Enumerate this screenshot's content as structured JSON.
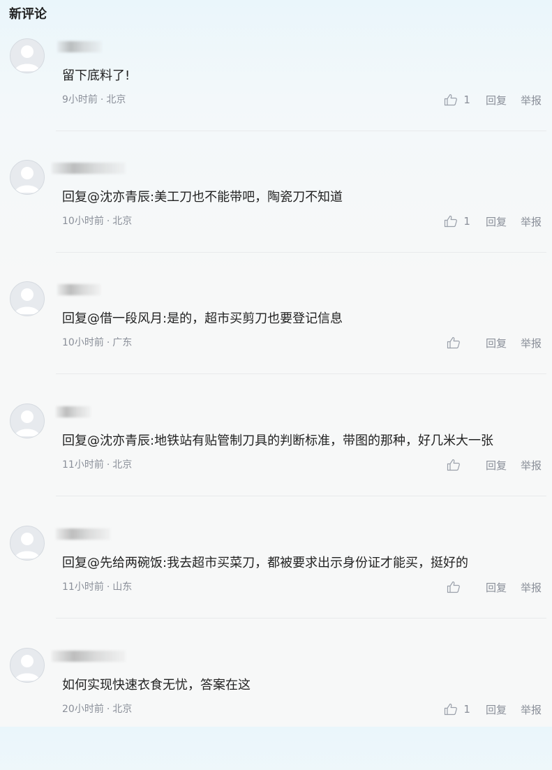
{
  "section_title": "新评论",
  "comments": [
    {
      "text": "留下底料了!",
      "time": "9小时前",
      "location": "北京",
      "likes": "1",
      "reply_label": "回复",
      "report_label": "举报"
    },
    {
      "text": "回复@沈亦青辰:美工刀也不能带吧，陶瓷刀不知道",
      "time": "10小时前",
      "location": "北京",
      "likes": "1",
      "reply_label": "回复",
      "report_label": "举报"
    },
    {
      "text": "回复@借一段风月:是的，超市买剪刀也要登记信息",
      "time": "10小时前",
      "location": "广东",
      "likes": "",
      "reply_label": "回复",
      "report_label": "举报"
    },
    {
      "text": "回复@沈亦青辰:地铁站有贴管制刀具的判断标准，带图的那种，好几米大一张",
      "time": "11小时前",
      "location": "北京",
      "likes": "",
      "reply_label": "回复",
      "report_label": "举报"
    },
    {
      "text": "回复@先给两碗饭:我去超市买菜刀，都被要求出示身份证才能买，挺好的",
      "time": "11小时前",
      "location": "山东",
      "likes": "",
      "reply_label": "回复",
      "report_label": "举报"
    },
    {
      "text": "如何实现快速衣食无忧，答案在这",
      "time": "20小时前",
      "location": "北京",
      "likes": "1",
      "reply_label": "回复",
      "report_label": "举报"
    }
  ],
  "separator": "·",
  "colors": {
    "text": "#222222",
    "meta": "#8a8f99",
    "divider": "#e8eaec"
  },
  "icons": {
    "avatar": "default-avatar-icon",
    "like": "thumbs-up-icon"
  }
}
